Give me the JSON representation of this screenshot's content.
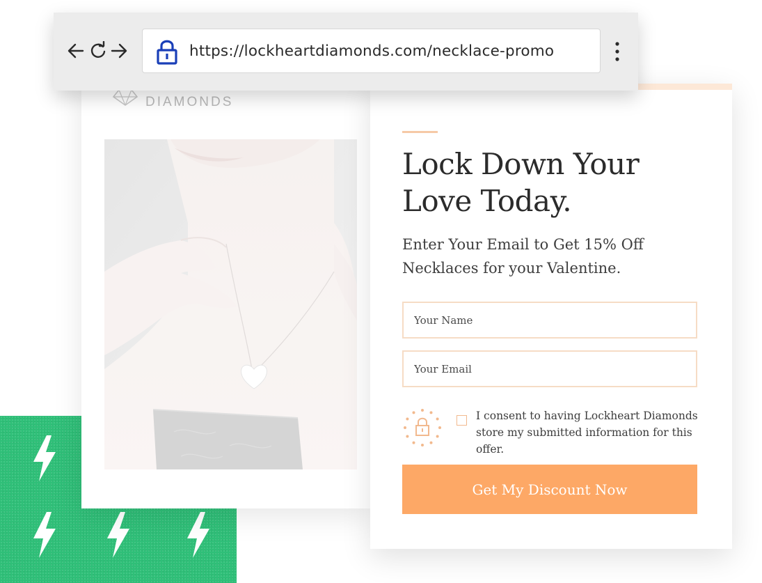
{
  "browser": {
    "url": "https://lockheartdiamonds.com/necklace-promo",
    "back_icon": "arrow-left-icon",
    "reload_icon": "reload-icon",
    "forward_icon": "arrow-right-icon",
    "lock_icon": "padlock-icon",
    "menu_icon": "kebab-menu-icon"
  },
  "brand": {
    "name": "DIAMONDS",
    "mark_icon": "diamond-logo-icon"
  },
  "hero_image": {
    "subject": "woman-wearing-heart-pendant-necklace"
  },
  "form": {
    "headline": "Lock Down Your Love Today.",
    "subhead": "Enter Your Email to Get 15% Off Necklaces for your Valentine.",
    "name_placeholder": "Your Name",
    "email_placeholder": "Your Email",
    "consent_text": "I consent to having Lockheart Diamonds store my submitted information for this offer.",
    "consent_checked": false,
    "seal_icon": "privacy-padlock-stars-icon",
    "cta_label": "Get My Discount Now"
  },
  "decoration": {
    "pattern_icon": "lightning-bolt-icon"
  },
  "colors": {
    "accent_peach": "#fda866",
    "peach_light": "#f6dcc5",
    "green": "#2fbf78",
    "lock_blue": "#1a3fb8",
    "text_dark": "#2b2b2b"
  }
}
